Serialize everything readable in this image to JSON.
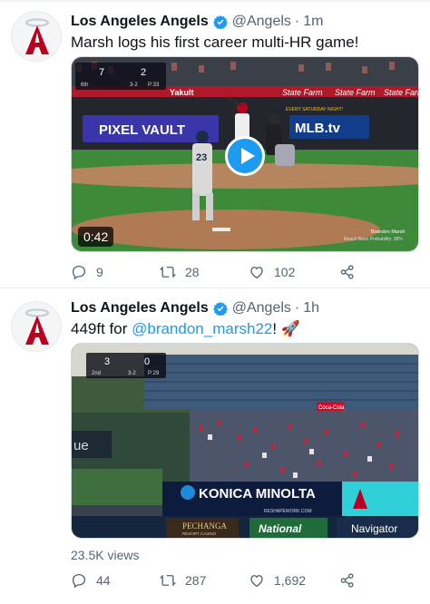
{
  "tweets": [
    {
      "name": "Los Angeles Angels",
      "handle": "@Angels",
      "time": "1m",
      "text": "Marsh logs his first career multi-HR game!",
      "media": {
        "duration": "0:42",
        "scorebug": {
          "away_score": "7",
          "home_score": "2",
          "inning": "6th",
          "count": "3-2",
          "clock": "P:33"
        },
        "signs": [
          "Yakult",
          "State Farm",
          "PIXEL VAULT",
          "MLB.tv",
          "EVERY SATURDAY NIGHT!"
        ],
        "player_number": "23",
        "player_name": "PETERS",
        "lower_third": [
          "Brandon Marsh",
          "Reach Base Probability: 38%"
        ]
      },
      "actions": {
        "replies": "9",
        "retweets": "28",
        "likes": "102"
      }
    },
    {
      "name": "Los Angeles Angels",
      "handle": "@Angels",
      "time": "1h",
      "text_before": "449ft for ",
      "mention": "@brandon_marsh22",
      "text_after": "! 🚀",
      "media": {
        "scorebug": {
          "away_score": "3",
          "home_score": "0",
          "inning": "2nd",
          "count": "3-2",
          "clock": "P:29"
        },
        "signs": [
          "KONICA MINOLTA",
          "RESHAPEWORK.COM",
          "PECHANGA",
          "RESORT CASINO",
          "National",
          "Navigator",
          "Coca-Cola",
          "ue"
        ]
      },
      "views": "23.5K views",
      "actions": {
        "replies": "44",
        "retweets": "287",
        "likes": "1,692"
      }
    }
  ],
  "colors": {
    "accent": "#1d9bf0",
    "secondary_text": "#536471",
    "angels_red": "#ba0021"
  },
  "icons": [
    "angels-logo-icon",
    "verified-badge-icon",
    "play-icon",
    "reply-icon",
    "retweet-icon",
    "like-icon",
    "share-icon",
    "rocket-emoji"
  ]
}
